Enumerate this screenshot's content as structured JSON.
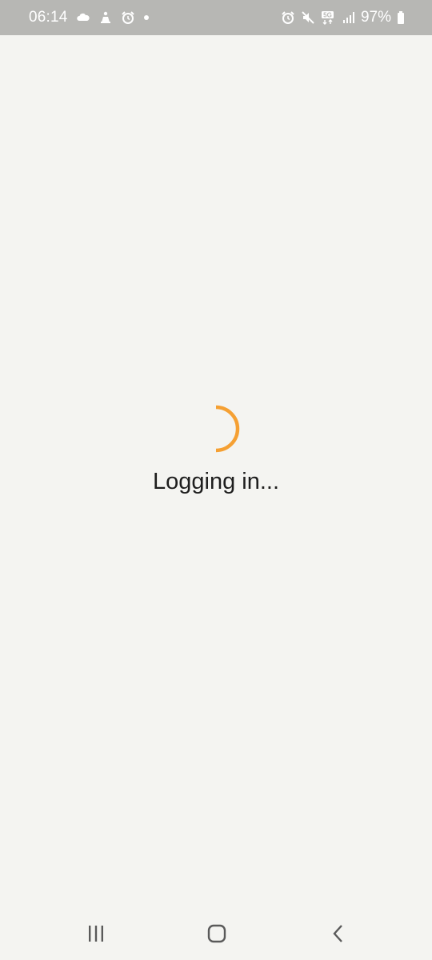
{
  "status_bar": {
    "time": "06:14",
    "battery_percent": "97%",
    "left_icons": [
      "cloud-icon",
      "hand-icon",
      "alarm-icon",
      "notification-dot-icon"
    ],
    "right_icons": [
      "alarm-icon",
      "mute-icon",
      "5g-signal-icon",
      "cell-signal-icon",
      "battery-icon"
    ],
    "network_label": "5G"
  },
  "main": {
    "loading_text": "Logging in...",
    "spinner_color": "#f5a033"
  },
  "nav_bar": {
    "buttons": [
      "recents-icon",
      "home-icon",
      "back-icon"
    ]
  },
  "colors": {
    "background": "#f4f4f1",
    "status_bar": "#b7b7b4",
    "text": "#1e1e1e",
    "nav_icon": "#5a5a5a"
  }
}
